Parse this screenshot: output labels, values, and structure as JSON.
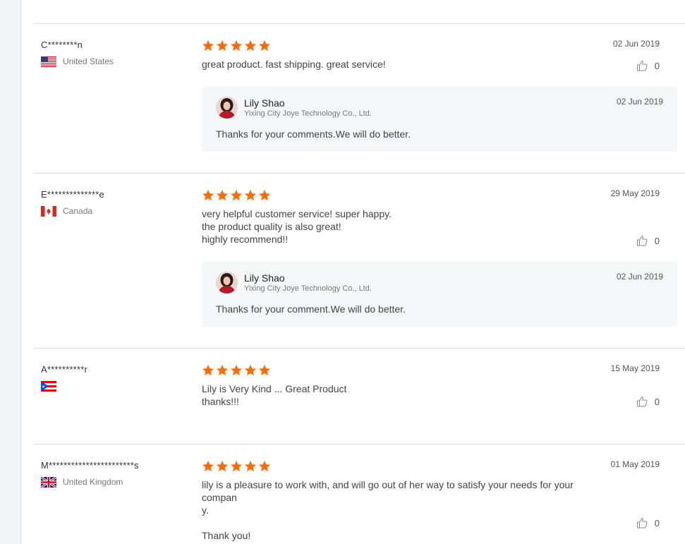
{
  "reviews": [
    {
      "buyer": "C********n",
      "country": "United States",
      "flag": "us-flag-icon",
      "rating": 5,
      "date": "02 Jun 2019",
      "text": "great product. fast shipping. great service!",
      "likes": "0",
      "reply": {
        "name": "Lily Shao",
        "company": "Yixing City Joye Technology Co., Ltd.",
        "date": "02 Jun 2019",
        "text": "Thanks for your comments.We will do better."
      }
    },
    {
      "buyer": "E**************e",
      "country": "Canada",
      "flag": "canada-flag-icon",
      "rating": 5,
      "date": "29 May 2019",
      "text": "very helpful customer service! super happy.\nthe product quality is also great!\nhighly recommend!!",
      "likes": "0",
      "reply": {
        "name": "Lily Shao",
        "company": "Yixing City Joye Technology Co., Ltd.",
        "date": "02 Jun 2019",
        "text": "Thanks for your comment.We will do better."
      }
    },
    {
      "buyer": "A**********r",
      "country": "",
      "flag": "puerto-rico-flag-icon",
      "rating": 5,
      "date": "15 May 2019",
      "text": "Lily is Very Kind ... Great Product\nthanks!!!",
      "likes": "0"
    },
    {
      "buyer": "M***********************s",
      "country": "United Kingdom",
      "flag": "uk-flag-icon",
      "rating": 5,
      "date": "01 May 2019",
      "text": "lily is a pleasure to work with, and will go out of her way to satisfy your needs for your compan\ny.\n\nThank you!",
      "likes": "0"
    }
  ],
  "colors": {
    "star": "#ff6a00",
    "divider": "#dcdde2",
    "reply_bg": "#f5f6f8"
  }
}
